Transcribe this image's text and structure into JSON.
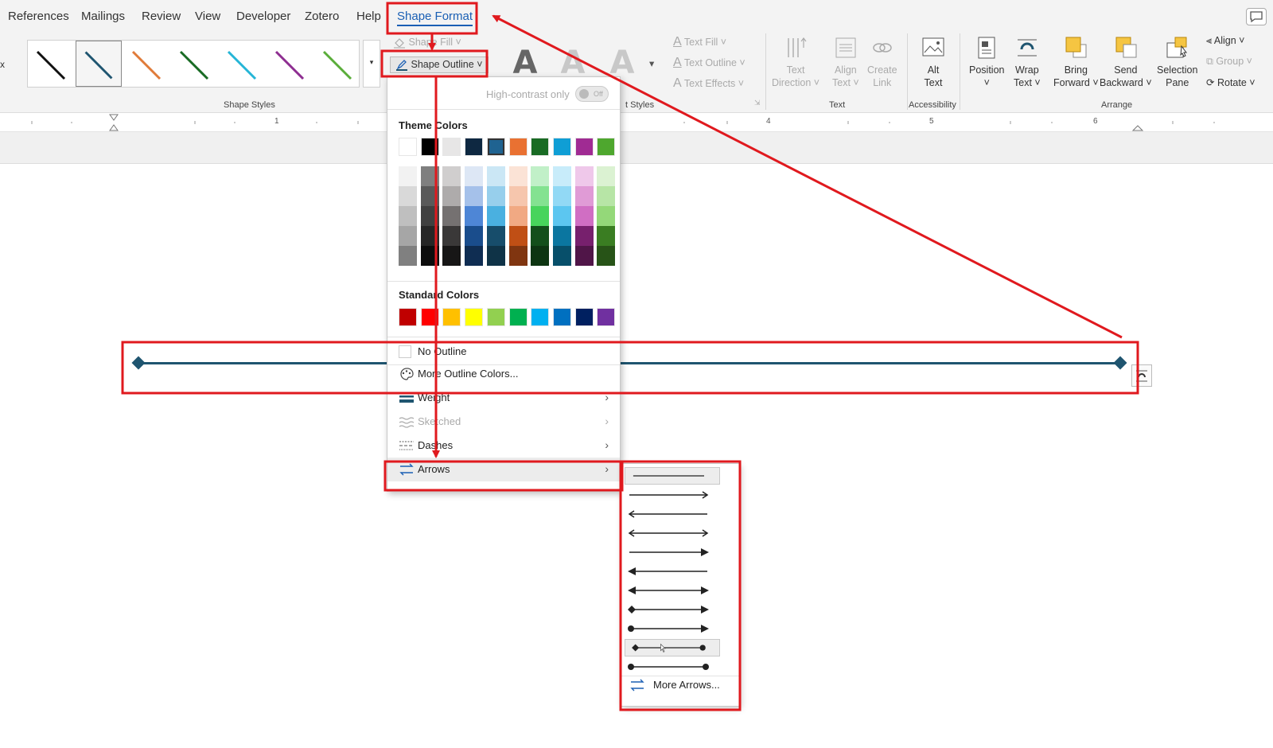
{
  "tabs": [
    {
      "label": "References"
    },
    {
      "label": "Mailings"
    },
    {
      "label": "Review"
    },
    {
      "label": "View"
    },
    {
      "label": "Developer"
    },
    {
      "label": "Zotero"
    },
    {
      "label": "Help"
    },
    {
      "label": "Shape Format"
    }
  ],
  "ribbon": {
    "shape_styles_label": "Shape Styles",
    "shape_fill": "Shape Fill",
    "shape_outline": "Shape Outline",
    "wordart_styles_label": "t Styles",
    "text_fill": "Text Fill",
    "text_outline": "Text Outline",
    "text_effects": "Text Effects",
    "text_direction": [
      "Text",
      "Direction"
    ],
    "align_text": [
      "Align",
      "Text"
    ],
    "create_link": [
      "Create",
      "Link"
    ],
    "text_group_label": "Text",
    "alt_text": [
      "Alt",
      "Text"
    ],
    "accessibility_label": "Accessibility",
    "position": [
      "Position"
    ],
    "wrap_text": [
      "Wrap",
      "Text"
    ],
    "bring_forward": [
      "Bring",
      "Forward"
    ],
    "send_backward": [
      "Send",
      "Backward"
    ],
    "selection_pane": [
      "Selection",
      "Pane"
    ],
    "align": "Align",
    "group": "Group",
    "rotate": "Rotate",
    "arrange_label": "Arrange",
    "left_edge": "x"
  },
  "ruler": {
    "numbers": [
      "1",
      "4",
      "5",
      "6"
    ]
  },
  "dropdown": {
    "high_contrast": "High-contrast only",
    "toggle_state": "Off",
    "theme_colors_title": "Theme Colors",
    "theme_row": [
      "#ffffff",
      "#000000",
      "#e7e6e6",
      "#0e2841",
      "#1f6391",
      "#e97132",
      "#196b24",
      "#0f9ed5",
      "#a02b93",
      "#4ea72e"
    ],
    "theme_shades": [
      [
        "#f2f2f2",
        "#d9d9d9",
        "#bfbfbf",
        "#a6a6a6",
        "#808080"
      ],
      [
        "#7f7f7f",
        "#595959",
        "#404040",
        "#262626",
        "#0d0d0d"
      ],
      [
        "#d0cece",
        "#aeabab",
        "#757171",
        "#3a3838",
        "#171616"
      ],
      [
        "#dde7f5",
        "#a5c1ea",
        "#4e86d6",
        "#1a4d8c",
        "#0f2d52"
      ],
      [
        "#cbe7f5",
        "#97cfec",
        "#4ab0e0",
        "#174d6b",
        "#0f3347"
      ],
      [
        "#fbe3d6",
        "#f6c6ad",
        "#f1a983",
        "#c04f15",
        "#803510"
      ],
      [
        "#c1f0c8",
        "#84e291",
        "#48d45c",
        "#134f1b",
        "#0d3512"
      ],
      [
        "#c8ecfa",
        "#92d9f5",
        "#5cc6f0",
        "#0b76a0",
        "#074f6a"
      ],
      [
        "#efc8ea",
        "#e09bd6",
        "#d06ec3",
        "#77206d",
        "#501548"
      ],
      [
        "#dbf2d2",
        "#b7e5a6",
        "#94d879",
        "#3a7d22",
        "#275317"
      ]
    ],
    "standard_colors_title": "Standard Colors",
    "standard_row": [
      "#c00000",
      "#ff0000",
      "#ffc000",
      "#ffff00",
      "#92d050",
      "#00b050",
      "#00b0f0",
      "#0070c0",
      "#002060",
      "#7030a0"
    ],
    "no_outline": "No Outline",
    "more_outline_colors": "More Outline Colors...",
    "weight": "Weight",
    "sketched": "Sketched",
    "dashes": "Dashes",
    "arrows": "Arrows"
  },
  "submenu": {
    "more_arrows": "More Arrows..."
  },
  "colors": {
    "accent": "#1a5fb4",
    "annotation_red": "#e0191e",
    "line_color": "#1f5570"
  }
}
